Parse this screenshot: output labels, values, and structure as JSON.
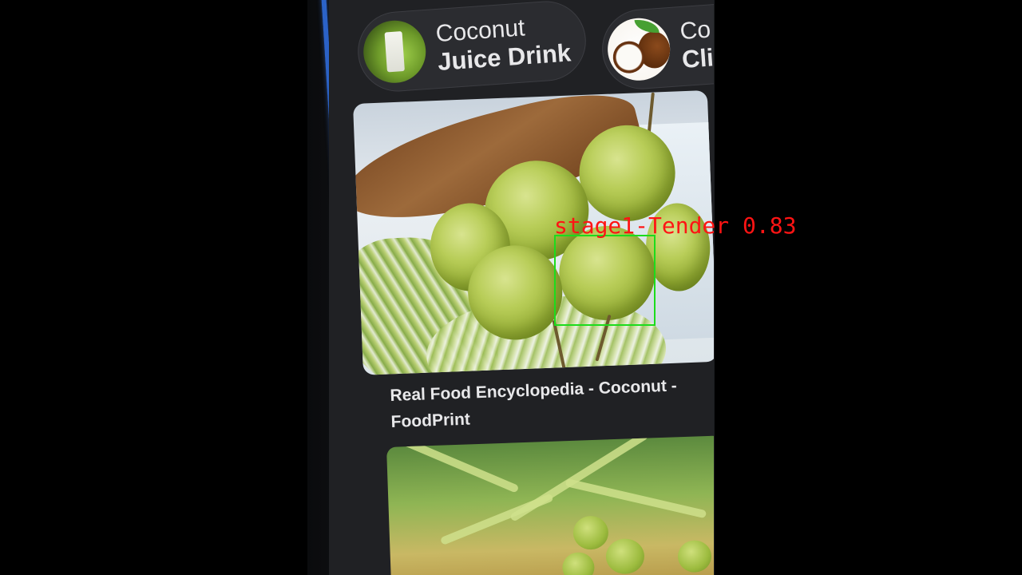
{
  "chips": [
    {
      "line1": "Coconut",
      "line2": "Juice Drink",
      "thumb": "coconut-juice-thumbnail"
    },
    {
      "line1": "Co",
      "line2": "Cli",
      "thumb": "coconut-halves-thumbnail"
    }
  ],
  "results": [
    {
      "caption": "Real Food Encyclopedia - Coconut - FoodPrint",
      "image": "green-coconut-cluster-photo"
    },
    {
      "caption": "",
      "image": "coconut-palm-photo"
    }
  ],
  "detection": {
    "label": "stage1-Tender 0.83",
    "box_color": "#1cdc1c",
    "label_color": "#ff1414"
  },
  "colors": {
    "background": "#000000",
    "screen": "#202124",
    "chip": "#2b2c30",
    "text": "#e8e8ea",
    "phone_edge": "#2a5fbf"
  }
}
